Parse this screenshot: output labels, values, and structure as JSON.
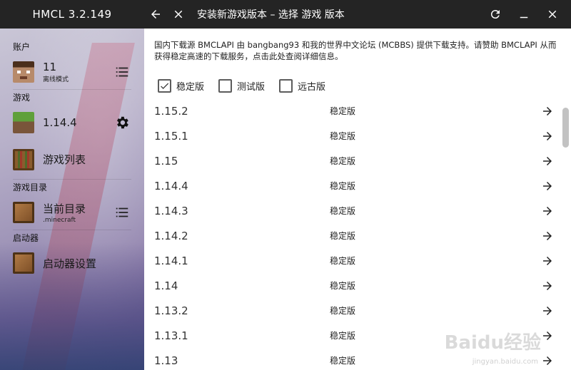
{
  "titlebar": {
    "app_title": "HMCL 3.2.149",
    "page_title": "安装新游戏版本 – 选择 游戏 版本",
    "icons": [
      "back-arrow-icon",
      "close-icon",
      "refresh-icon",
      "minimize-icon",
      "window-close-icon"
    ]
  },
  "sidebar": {
    "sections": {
      "account": "账户",
      "game": "游戏",
      "game_dir": "游戏目录",
      "launcher": "启动器"
    },
    "account_item": {
      "title": "11",
      "subtitle": "离线模式"
    },
    "version_item": {
      "title": "1.14.4"
    },
    "game_list_item": {
      "title": "游戏列表"
    },
    "dir_item": {
      "title": "当前目录",
      "subtitle": ".minecraft"
    },
    "launcher_settings_item": {
      "title": "启动器设置"
    }
  },
  "content": {
    "notice": "国内下载源 BMCLAPI 由 bangbang93 和我的世界中文论坛 (MCBBS) 提供下载支持。请赞助 BMCLAPI 从而获得稳定高速的下载服务，点击此处查阅详细信息。",
    "filters": [
      {
        "label": "稳定版",
        "checked": true
      },
      {
        "label": "测试版",
        "checked": false
      },
      {
        "label": "远古版",
        "checked": false
      }
    ],
    "versions": [
      {
        "version": "1.15.2",
        "type": "稳定版"
      },
      {
        "version": "1.15.1",
        "type": "稳定版"
      },
      {
        "version": "1.15",
        "type": "稳定版"
      },
      {
        "version": "1.14.4",
        "type": "稳定版"
      },
      {
        "version": "1.14.3",
        "type": "稳定版"
      },
      {
        "version": "1.14.2",
        "type": "稳定版"
      },
      {
        "version": "1.14.1",
        "type": "稳定版"
      },
      {
        "version": "1.14",
        "type": "稳定版"
      },
      {
        "version": "1.13.2",
        "type": "稳定版"
      },
      {
        "version": "1.13.1",
        "type": "稳定版"
      },
      {
        "version": "1.13",
        "type": "稳定版"
      }
    ],
    "watermark": "Baidu经验",
    "watermark_sub": "jingyan.baidu.com"
  },
  "colors": {
    "titlebar_bg": "#242424",
    "content_bg": "#ffffff",
    "icon_dark": "#222222"
  }
}
